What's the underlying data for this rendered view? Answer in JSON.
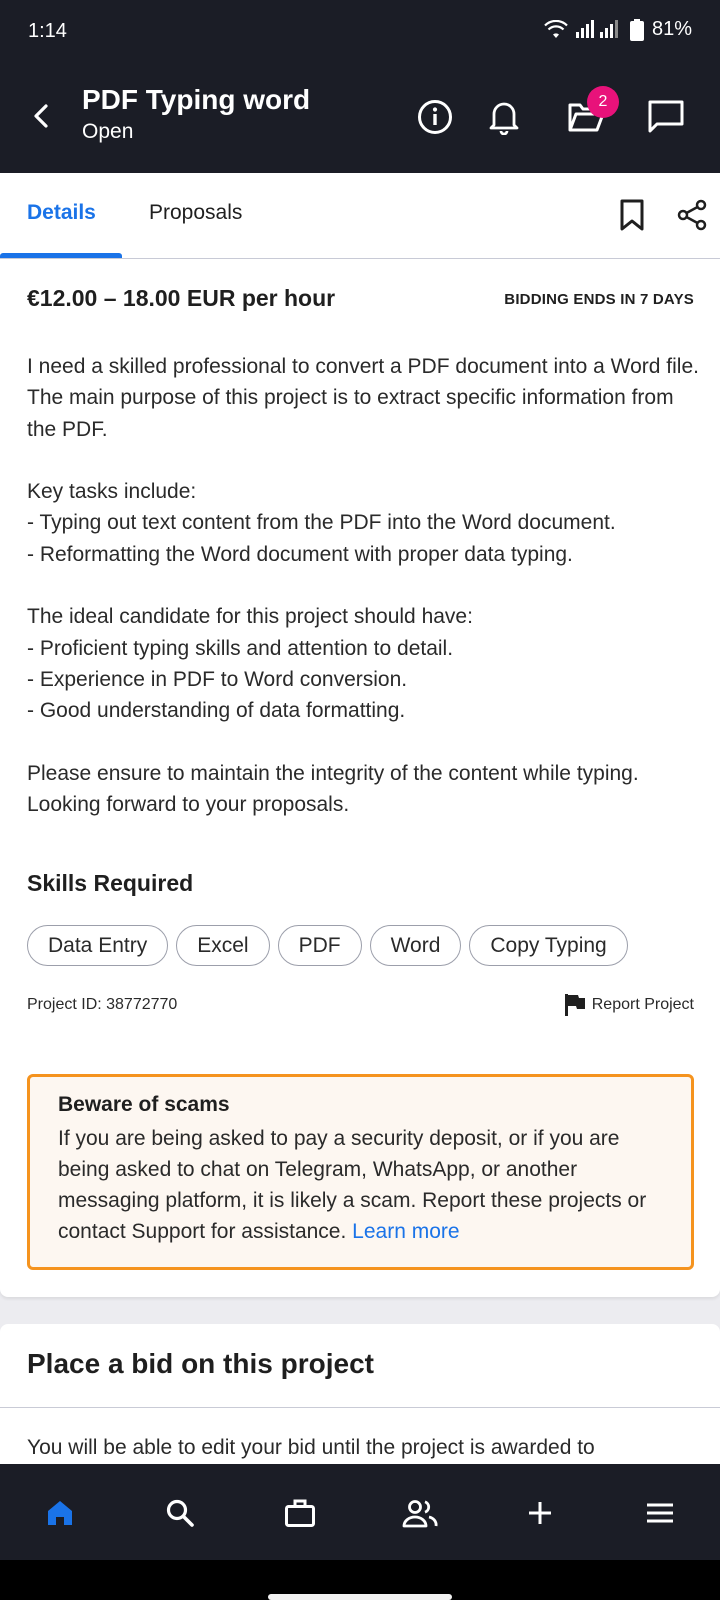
{
  "status_bar": {
    "time": "1:14",
    "battery": "81%"
  },
  "header": {
    "title": "PDF Typing word",
    "subtitle": "Open",
    "inbox_badge": "2"
  },
  "tabs": [
    {
      "label": "Details"
    },
    {
      "label": "Proposals"
    }
  ],
  "project": {
    "rate": "€12.00 – 18.00 EUR per hour",
    "bidding_ends": "BIDDING ENDS IN 7 DAYS",
    "description": [
      "I need a skilled professional to convert a PDF document into a Word file. The main purpose of this project is to extract specific information from the PDF.",
      "",
      "Key tasks include:",
      "- Typing out text content from the PDF into the Word document.",
      "- Reformatting the Word document with proper data typing.",
      "",
      "The ideal candidate for this project should have:",
      "- Proficient typing skills and attention to detail.",
      "- Experience in PDF to Word conversion.",
      "- Good understanding of data formatting.",
      "",
      "Please ensure to maintain the integrity of the content while typing. Looking forward to your proposals."
    ],
    "skills_title": "Skills Required",
    "skills": [
      "Data Entry",
      "Excel",
      "PDF",
      "Word",
      "Copy Typing"
    ],
    "project_id": "Project ID: 38772770",
    "report_label": "Report Project"
  },
  "warning": {
    "title": "Beware of scams",
    "text": "If you are being asked to pay a security deposit, or if you are being asked to chat on Telegram, WhatsApp, or another messaging platform, it is likely a scam. Report these projects or contact Support for assistance.",
    "link": "Learn more"
  },
  "bid": {
    "title": "Place a bid on this project",
    "text": "You will be able to edit your bid until the project is awarded to"
  },
  "bottom_nav": [
    "home-icon",
    "search-icon",
    "briefcase-icon",
    "people-icon",
    "plus-icon",
    "menu-icon"
  ],
  "colors": {
    "dark": "#1b1d26",
    "accent": "#1a73e8",
    "badge": "#e8127a",
    "warning_border": "#f5931e",
    "warning_bg": "#fdf7f1"
  }
}
